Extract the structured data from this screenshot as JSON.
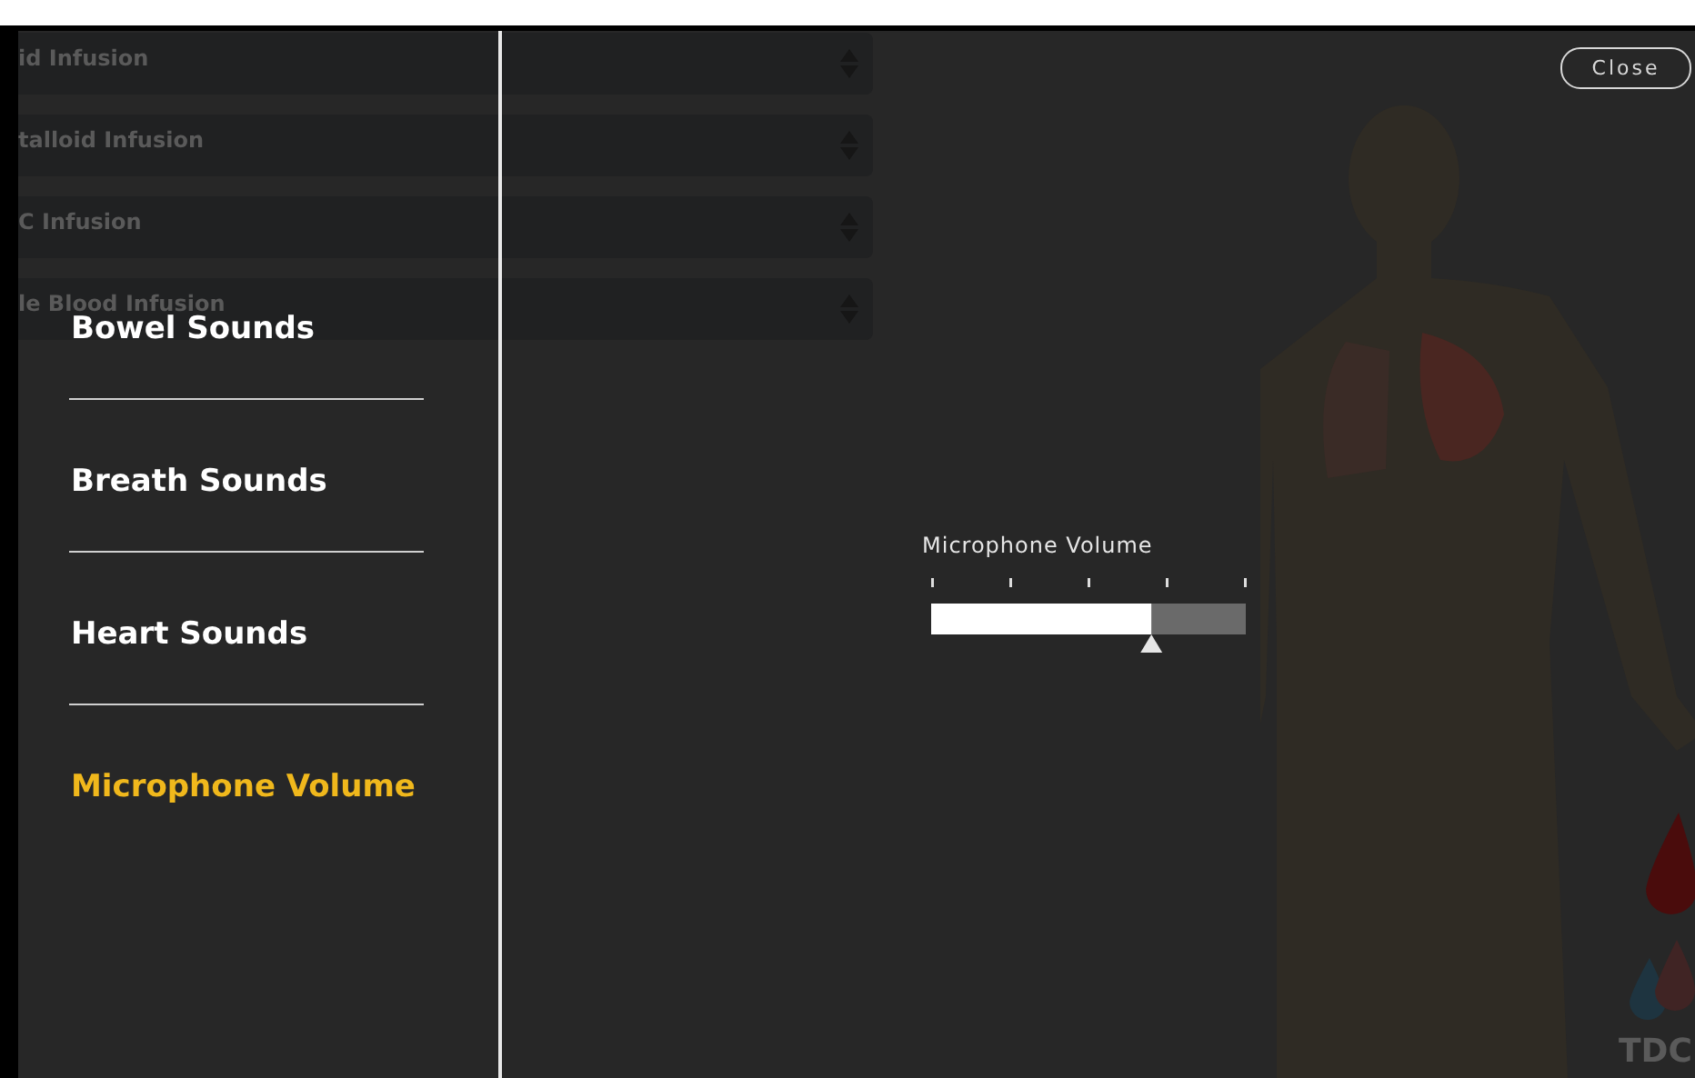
{
  "infusion_rows": [
    {
      "label": "id Infusion"
    },
    {
      "label": "talloid Infusion"
    },
    {
      "label": "C Infusion"
    },
    {
      "label": "le Blood Infusion"
    }
  ],
  "menu": {
    "items": [
      {
        "label": "Bowel Sounds",
        "selected": false
      },
      {
        "label": "Breath Sounds",
        "selected": false
      },
      {
        "label": "Heart Sounds",
        "selected": false
      },
      {
        "label": "Microphone Volume",
        "selected": true
      }
    ]
  },
  "volume": {
    "label": "Microphone Volume",
    "level": 0.7
  },
  "close_button": "Close",
  "logo": {
    "text": "TDC"
  }
}
